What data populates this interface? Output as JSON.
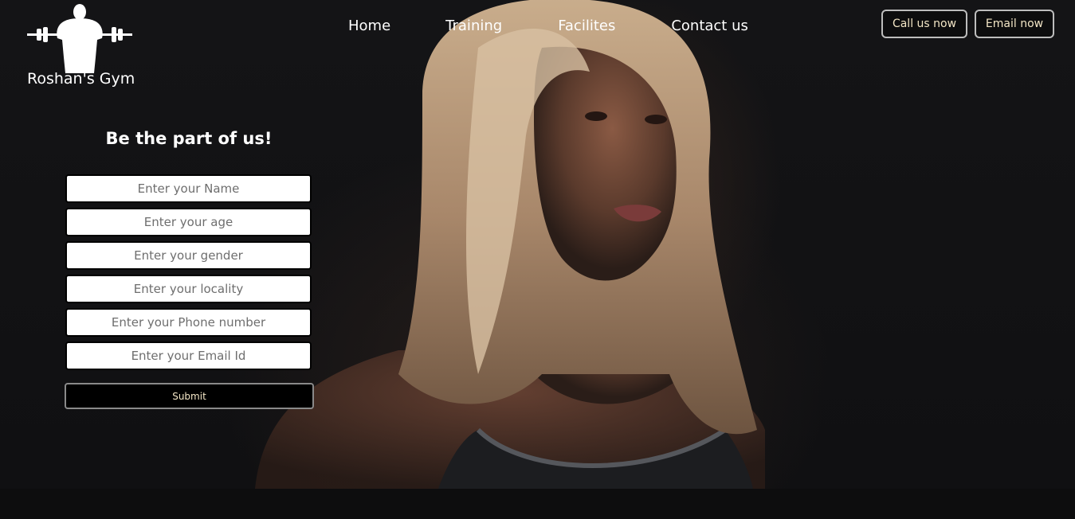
{
  "brand": {
    "name": "Roshan's Gym",
    "logo_icon": "weightlifter-icon"
  },
  "nav": {
    "items": [
      {
        "label": "Home"
      },
      {
        "label": "Training"
      },
      {
        "label": "Facilites"
      },
      {
        "label": "Contact us"
      }
    ]
  },
  "header_buttons": {
    "call": "Call us now",
    "email": "Email now"
  },
  "form": {
    "title": "Be the part of us!",
    "fields": [
      {
        "placeholder": "Enter your Name"
      },
      {
        "placeholder": "Enter your age"
      },
      {
        "placeholder": "Enter your gender"
      },
      {
        "placeholder": "Enter your locality"
      },
      {
        "placeholder": "Enter your Phone number"
      },
      {
        "placeholder": "Enter your Email Id"
      }
    ],
    "submit": "Submit"
  },
  "colors": {
    "background": "#111113",
    "button_text": "#f3e6c6",
    "button_border": "#bdbdbd"
  }
}
